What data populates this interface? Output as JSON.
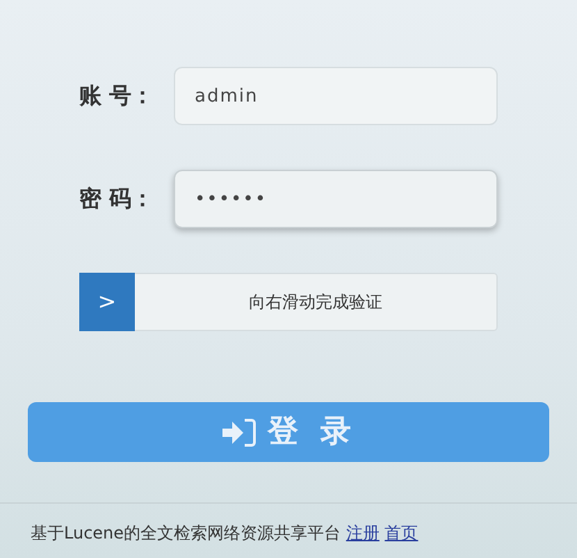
{
  "fields": [
    {
      "label": "账 号：",
      "value": "admin",
      "focused": false
    },
    {
      "label": "密 码：",
      "value": "••••••",
      "focused": true
    }
  ],
  "slider": {
    "handle": ">",
    "text": "向右滑动完成验证"
  },
  "login_button": {
    "label": "登 录"
  },
  "footer": {
    "text": "基于Lucene的全文检索网络资源共享平台",
    "links": [
      "注册",
      "首页"
    ]
  }
}
